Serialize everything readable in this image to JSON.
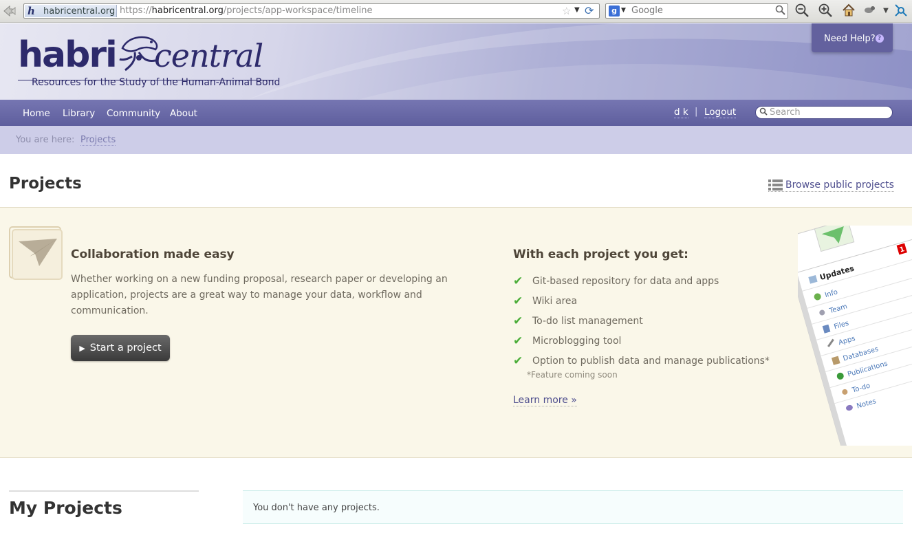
{
  "browser": {
    "site_identity": "habricentral.org",
    "url_scheme": "https://",
    "url_domain": "habricentral.org",
    "url_path": "/projects/app-workspace/timeline",
    "search_engine_placeholder": "Google"
  },
  "header": {
    "logo_word1": "habri",
    "logo_word2": "central",
    "tagline": "Resources for the Study of the Human-Animal Bond",
    "help_label": "Need Help?"
  },
  "nav": {
    "items": [
      {
        "label": "Home"
      },
      {
        "label": "Library"
      },
      {
        "label": "Community"
      },
      {
        "label": "About"
      }
    ],
    "user": "d k",
    "separator": "|",
    "logout": "Logout",
    "search_placeholder": "Search"
  },
  "breadcrumb": {
    "label": "You are here:",
    "current": "Projects"
  },
  "page": {
    "title": "Projects",
    "browse_link": "Browse public projects"
  },
  "intro": {
    "heading": "Collaboration made easy",
    "text": "Whether working on a new funding proposal, research paper or developing an application, projects are a great way to manage your data, workflow and communication.",
    "start_button": "Start a project",
    "features_heading": "With each project you get:",
    "features": [
      "Git-based repository for data and apps",
      "Wiki area",
      "To-do list management",
      "Microblogging tool",
      "Option to publish data and manage publications*"
    ],
    "feature_note": "*Feature coming soon",
    "learn_more": "Learn more »",
    "preview_menu": {
      "badge": "1",
      "items": [
        "Updates",
        "Info",
        "Team",
        "Files",
        "Apps",
        "Databases",
        "Publications",
        "To-do",
        "Notes"
      ]
    }
  },
  "my_projects": {
    "title": "My Projects",
    "empty_message": "You don't have any projects."
  },
  "colors": {
    "brand": "#2d2a6b",
    "nav": "#6a6aa8",
    "breadcrumb_bg": "#cdcde8",
    "intro_bg": "#faf7e9",
    "check": "#4cae3a",
    "link": "#4e4e8e"
  }
}
